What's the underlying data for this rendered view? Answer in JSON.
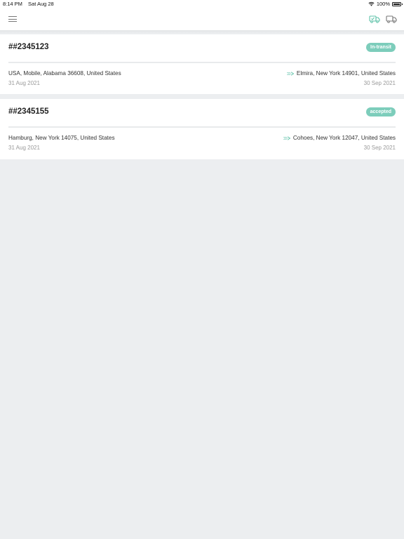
{
  "status_bar": {
    "time": "8:14 PM",
    "date": "Sat Aug 28",
    "battery": "100%"
  },
  "nav": {
    "menu_icon": "hamburger-menu-icon",
    "icons": [
      "truck-check-icon",
      "truck-icon"
    ]
  },
  "colors": {
    "badge": "#7dcdbb",
    "background": "#eceef0",
    "card": "#ffffff",
    "accent": "#5ec2a8"
  },
  "shipments": [
    {
      "id": "##2345123",
      "status": "In-transit",
      "origin": "USA, Mobile, Alabama 36608, United States",
      "origin_date": "31 Aug 2021",
      "destination": "Elmira, New York 14901, United States",
      "destination_date": "30 Sep 2021"
    },
    {
      "id": "##2345155",
      "status": "accepted",
      "origin": "Hamburg, New York 14075, United States",
      "origin_date": "31 Aug 2021",
      "destination": "Cohoes, New York 12047, United States",
      "destination_date": "30 Sep 2021"
    }
  ]
}
